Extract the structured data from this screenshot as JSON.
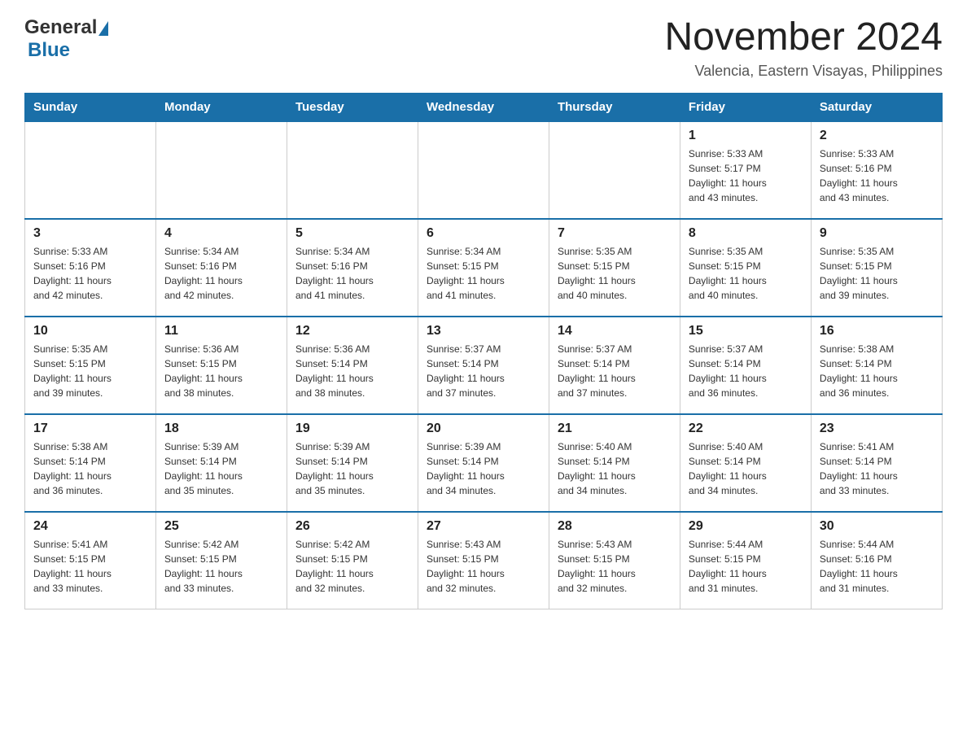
{
  "header": {
    "logo_general": "General",
    "logo_blue": "Blue",
    "month_title": "November 2024",
    "location": "Valencia, Eastern Visayas, Philippines"
  },
  "days_of_week": [
    "Sunday",
    "Monday",
    "Tuesday",
    "Wednesday",
    "Thursday",
    "Friday",
    "Saturday"
  ],
  "weeks": [
    [
      {
        "day": "",
        "info": ""
      },
      {
        "day": "",
        "info": ""
      },
      {
        "day": "",
        "info": ""
      },
      {
        "day": "",
        "info": ""
      },
      {
        "day": "",
        "info": ""
      },
      {
        "day": "1",
        "info": "Sunrise: 5:33 AM\nSunset: 5:17 PM\nDaylight: 11 hours\nand 43 minutes."
      },
      {
        "day": "2",
        "info": "Sunrise: 5:33 AM\nSunset: 5:16 PM\nDaylight: 11 hours\nand 43 minutes."
      }
    ],
    [
      {
        "day": "3",
        "info": "Sunrise: 5:33 AM\nSunset: 5:16 PM\nDaylight: 11 hours\nand 42 minutes."
      },
      {
        "day": "4",
        "info": "Sunrise: 5:34 AM\nSunset: 5:16 PM\nDaylight: 11 hours\nand 42 minutes."
      },
      {
        "day": "5",
        "info": "Sunrise: 5:34 AM\nSunset: 5:16 PM\nDaylight: 11 hours\nand 41 minutes."
      },
      {
        "day": "6",
        "info": "Sunrise: 5:34 AM\nSunset: 5:15 PM\nDaylight: 11 hours\nand 41 minutes."
      },
      {
        "day": "7",
        "info": "Sunrise: 5:35 AM\nSunset: 5:15 PM\nDaylight: 11 hours\nand 40 minutes."
      },
      {
        "day": "8",
        "info": "Sunrise: 5:35 AM\nSunset: 5:15 PM\nDaylight: 11 hours\nand 40 minutes."
      },
      {
        "day": "9",
        "info": "Sunrise: 5:35 AM\nSunset: 5:15 PM\nDaylight: 11 hours\nand 39 minutes."
      }
    ],
    [
      {
        "day": "10",
        "info": "Sunrise: 5:35 AM\nSunset: 5:15 PM\nDaylight: 11 hours\nand 39 minutes."
      },
      {
        "day": "11",
        "info": "Sunrise: 5:36 AM\nSunset: 5:15 PM\nDaylight: 11 hours\nand 38 minutes."
      },
      {
        "day": "12",
        "info": "Sunrise: 5:36 AM\nSunset: 5:14 PM\nDaylight: 11 hours\nand 38 minutes."
      },
      {
        "day": "13",
        "info": "Sunrise: 5:37 AM\nSunset: 5:14 PM\nDaylight: 11 hours\nand 37 minutes."
      },
      {
        "day": "14",
        "info": "Sunrise: 5:37 AM\nSunset: 5:14 PM\nDaylight: 11 hours\nand 37 minutes."
      },
      {
        "day": "15",
        "info": "Sunrise: 5:37 AM\nSunset: 5:14 PM\nDaylight: 11 hours\nand 36 minutes."
      },
      {
        "day": "16",
        "info": "Sunrise: 5:38 AM\nSunset: 5:14 PM\nDaylight: 11 hours\nand 36 minutes."
      }
    ],
    [
      {
        "day": "17",
        "info": "Sunrise: 5:38 AM\nSunset: 5:14 PM\nDaylight: 11 hours\nand 36 minutes."
      },
      {
        "day": "18",
        "info": "Sunrise: 5:39 AM\nSunset: 5:14 PM\nDaylight: 11 hours\nand 35 minutes."
      },
      {
        "day": "19",
        "info": "Sunrise: 5:39 AM\nSunset: 5:14 PM\nDaylight: 11 hours\nand 35 minutes."
      },
      {
        "day": "20",
        "info": "Sunrise: 5:39 AM\nSunset: 5:14 PM\nDaylight: 11 hours\nand 34 minutes."
      },
      {
        "day": "21",
        "info": "Sunrise: 5:40 AM\nSunset: 5:14 PM\nDaylight: 11 hours\nand 34 minutes."
      },
      {
        "day": "22",
        "info": "Sunrise: 5:40 AM\nSunset: 5:14 PM\nDaylight: 11 hours\nand 34 minutes."
      },
      {
        "day": "23",
        "info": "Sunrise: 5:41 AM\nSunset: 5:14 PM\nDaylight: 11 hours\nand 33 minutes."
      }
    ],
    [
      {
        "day": "24",
        "info": "Sunrise: 5:41 AM\nSunset: 5:15 PM\nDaylight: 11 hours\nand 33 minutes."
      },
      {
        "day": "25",
        "info": "Sunrise: 5:42 AM\nSunset: 5:15 PM\nDaylight: 11 hours\nand 33 minutes."
      },
      {
        "day": "26",
        "info": "Sunrise: 5:42 AM\nSunset: 5:15 PM\nDaylight: 11 hours\nand 32 minutes."
      },
      {
        "day": "27",
        "info": "Sunrise: 5:43 AM\nSunset: 5:15 PM\nDaylight: 11 hours\nand 32 minutes."
      },
      {
        "day": "28",
        "info": "Sunrise: 5:43 AM\nSunset: 5:15 PM\nDaylight: 11 hours\nand 32 minutes."
      },
      {
        "day": "29",
        "info": "Sunrise: 5:44 AM\nSunset: 5:15 PM\nDaylight: 11 hours\nand 31 minutes."
      },
      {
        "day": "30",
        "info": "Sunrise: 5:44 AM\nSunset: 5:16 PM\nDaylight: 11 hours\nand 31 minutes."
      }
    ]
  ]
}
